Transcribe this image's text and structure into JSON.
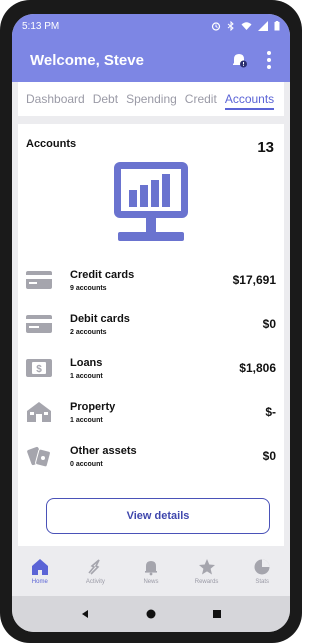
{
  "status_bar": {
    "time": "5:13 PM",
    "icons": [
      "alarm-icon",
      "bluetooth-icon",
      "wifi-icon",
      "signal-icon",
      "battery-icon"
    ]
  },
  "app_bar": {
    "title": "Welcome, Steve",
    "icons": [
      "notification-bell-icon",
      "more-vert-icon"
    ]
  },
  "tabs": [
    {
      "label": "Dashboard",
      "active": false
    },
    {
      "label": "Debt",
      "active": false
    },
    {
      "label": "Spending",
      "active": false
    },
    {
      "label": "Credit",
      "active": false
    },
    {
      "label": "Accounts",
      "active": true
    }
  ],
  "accounts": {
    "title": "Accounts",
    "count": "13",
    "illustration": "monitor-bar-chart-icon",
    "items": [
      {
        "icon": "credit-card-icon",
        "title": "Credit cards",
        "sub": "9 accounts",
        "value": "$17,691"
      },
      {
        "icon": "debit-card-icon",
        "title": "Debit cards",
        "sub": "2 accounts",
        "value": "$0"
      },
      {
        "icon": "loan-icon",
        "title": "Loans",
        "sub": "1 account",
        "value": "$1,806"
      },
      {
        "icon": "house-icon",
        "title": "Property",
        "sub": "1 account",
        "value": "$-"
      },
      {
        "icon": "other-assets-icon",
        "title": "Other assets",
        "sub": "0 account",
        "value": "$0"
      }
    ],
    "details_button": "View details"
  },
  "bottom_nav": [
    {
      "icon": "home-icon",
      "label": "Home",
      "active": true
    },
    {
      "icon": "activity-icon",
      "label": "Activity",
      "active": false
    },
    {
      "icon": "news-icon",
      "label": "News",
      "active": false
    },
    {
      "icon": "rewards-icon",
      "label": "Rewards",
      "active": false
    },
    {
      "icon": "stats-icon",
      "label": "Stats",
      "active": false
    }
  ],
  "system_nav": [
    "back-icon",
    "home-circle-icon",
    "recents-icon"
  ],
  "colors": {
    "primary": "#7d86e4",
    "accent": "#5b64d6",
    "illustration": "#6a73cf",
    "background": "#ececef"
  }
}
